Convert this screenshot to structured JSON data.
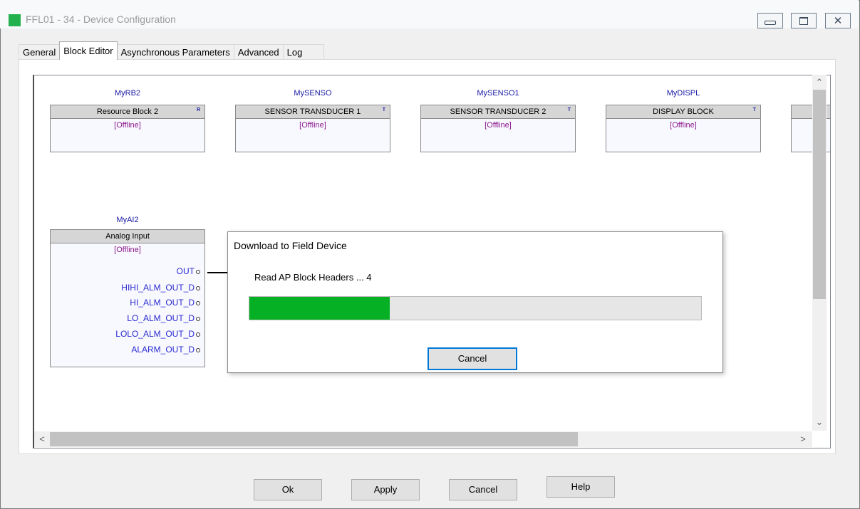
{
  "window": {
    "title": "FFL01 - 34 - Device Configuration",
    "controls": [
      "minimize",
      "maximize",
      "close"
    ]
  },
  "tabs": [
    {
      "label": "General",
      "active": false
    },
    {
      "label": "Block Editor",
      "active": true
    },
    {
      "label": "Asynchronous Parameters",
      "active": false
    },
    {
      "label": "Advanced",
      "active": false
    },
    {
      "label": "Log",
      "active": false
    }
  ],
  "blocks": [
    {
      "tag": "MyRB2",
      "name": "Resource Block 2",
      "type_mark": "R",
      "status": "[Offline]"
    },
    {
      "tag": "MySENSO",
      "name": "SENSOR  TRANSDUCER  1",
      "type_mark": "T",
      "status": "[Offline]"
    },
    {
      "tag": "MySENSO1",
      "name": "SENSOR  TRANSDUCER  2",
      "type_mark": "T",
      "status": "[Offline]"
    },
    {
      "tag": "MyDISPL",
      "name": "DISPLAY  BLOCK",
      "type_mark": "T",
      "status": "[Offline]"
    },
    {
      "tag": "MyAI2",
      "name": "Analog Input",
      "type_mark": "",
      "status": "[Offline]",
      "ports": [
        "OUT",
        "HIHI_ALM_OUT_D",
        "HI_ALM_OUT_D",
        "LO_ALM_OUT_D",
        "LOLO_ALM_OUT_D",
        "ALARM_OUT_D"
      ]
    }
  ],
  "dialog": {
    "title": "Download to Field Device",
    "message": "Read AP Block Headers ... 4",
    "progress_fraction": 0.31,
    "cancel_label": "Cancel"
  },
  "footer": {
    "ok_label": "Ok",
    "apply_label": "Apply",
    "cancel_label": "Cancel",
    "help_label": "Help"
  },
  "colors": {
    "progress": "#06b025",
    "app_icon": "#22b14c",
    "block_tag": "#1a1aa6",
    "status": "#8b1a8b",
    "port": "#2a2ad0"
  }
}
